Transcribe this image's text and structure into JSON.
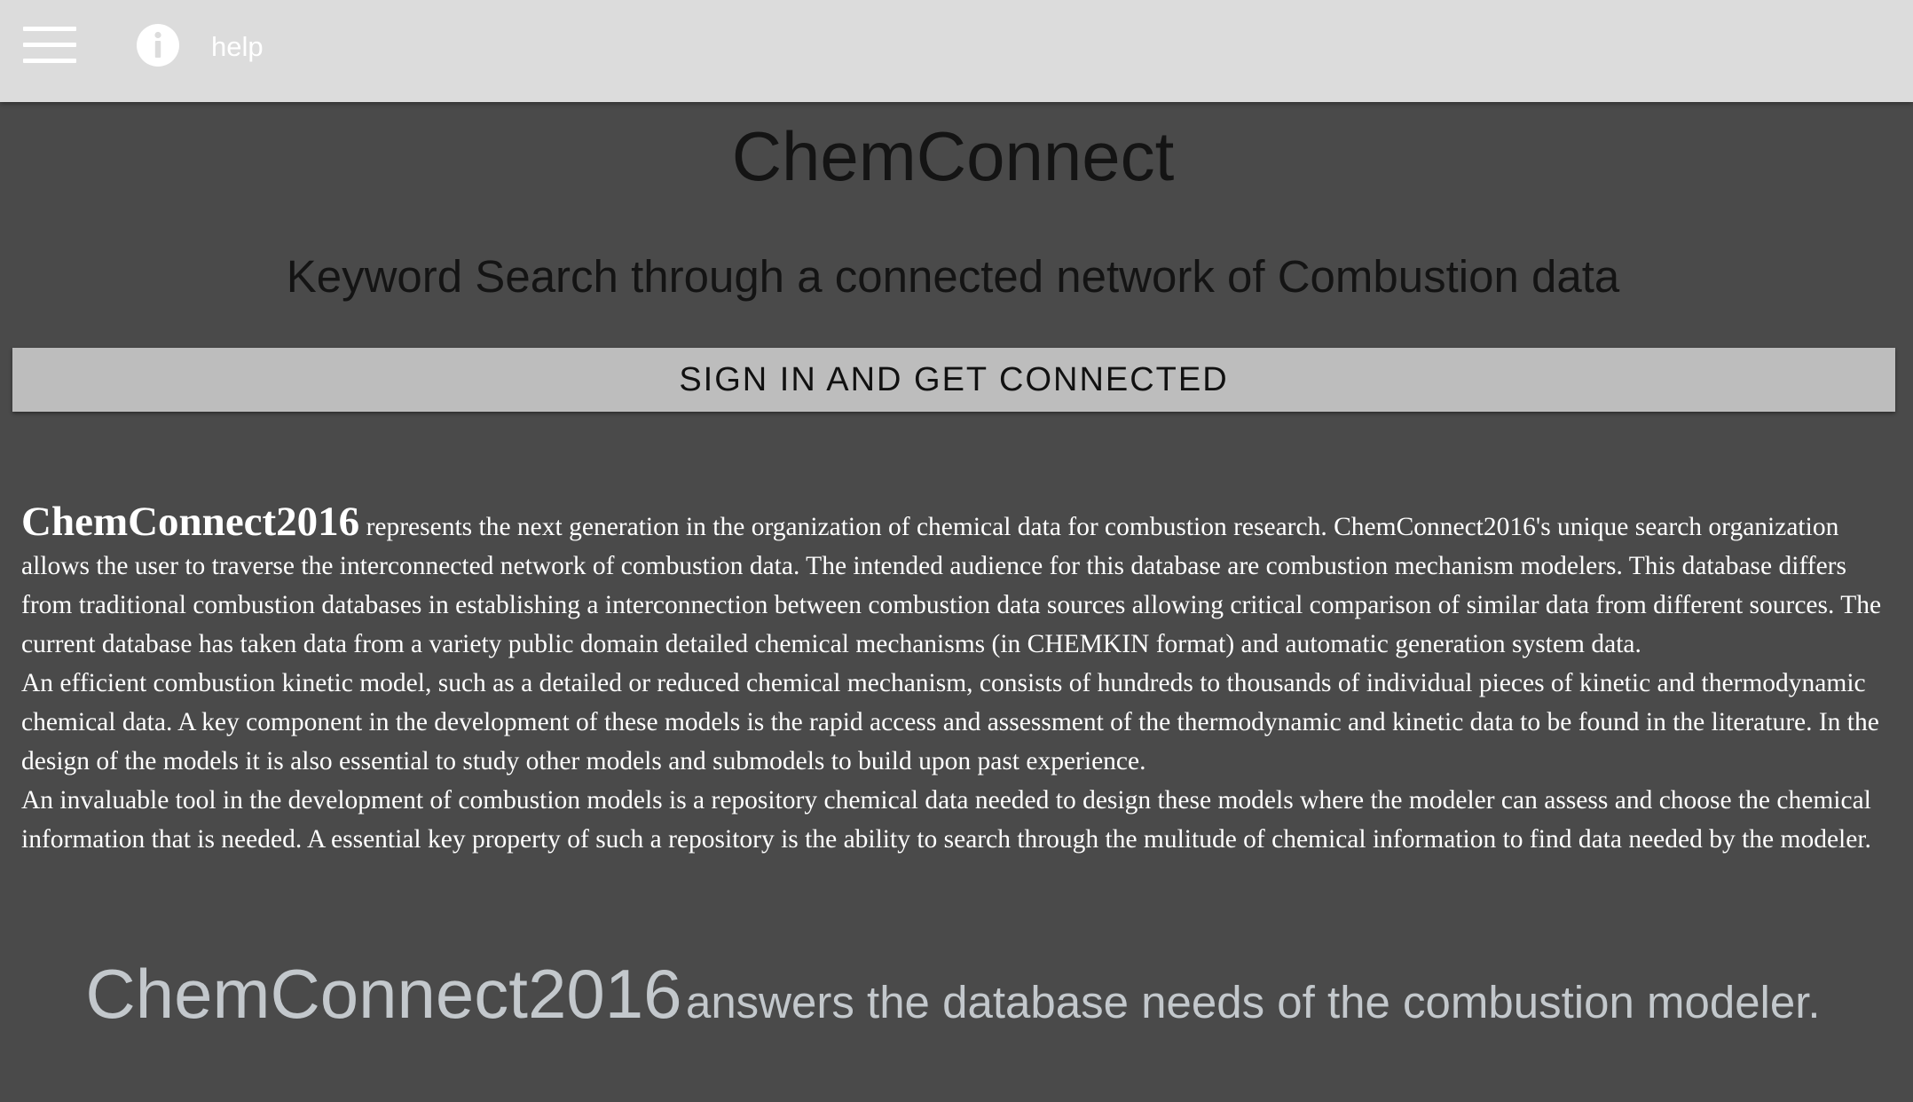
{
  "header": {
    "menu_icon": "hamburger-menu-icon",
    "info_icon": "info-circle-icon",
    "help_label": "help"
  },
  "main": {
    "title": "ChemConnect",
    "subtitle": "Keyword Search through a connected network of Combustion data",
    "signin_label": "SIGN IN AND GET CONNECTED"
  },
  "description": {
    "brand": "ChemConnect2016",
    "intro": "represents the next generation in the organization of chemical data for combustion research. ChemConnect2016's unique search organization allows the user to traverse the interconnected network of combustion data. The intended audience for this database are combustion mechanism modelers. This database differs from traditional combustion databases in establishing a interconnection between combustion data sources allowing critical comparison of similar data from different sources. The current database has taken data from a variety public domain detailed chemical mechanisms (in CHEMKIN format) and automatic generation system data.",
    "paragraph2": "An efficient combustion kinetic model, such as a detailed or reduced chemical mechanism, consists of hundreds to thousands of individual pieces of kinetic and thermodynamic chemical data. A key component in the development of these models is the rapid access and assessment of the thermodynamic and kinetic data to be found in the literature. In the design of the models it is also essential to study other models and submodels to build upon past experience.",
    "paragraph3": "An invaluable tool in the development of combustion models is a repository chemical data needed to design these models where the modeler can assess and choose the chemical information that is needed. A essential key property of such a repository is the ability to search through the mulitude of chemical information to find data needed by the modeler."
  },
  "tagline": {
    "brand": "ChemConnect2016",
    "text": "answers the database needs of the combustion modeler."
  },
  "colors": {
    "background": "#4a4a4a",
    "topbar": "#dcdcdc",
    "button": "#bdbdbd",
    "tagline": "#c3c8cc"
  }
}
